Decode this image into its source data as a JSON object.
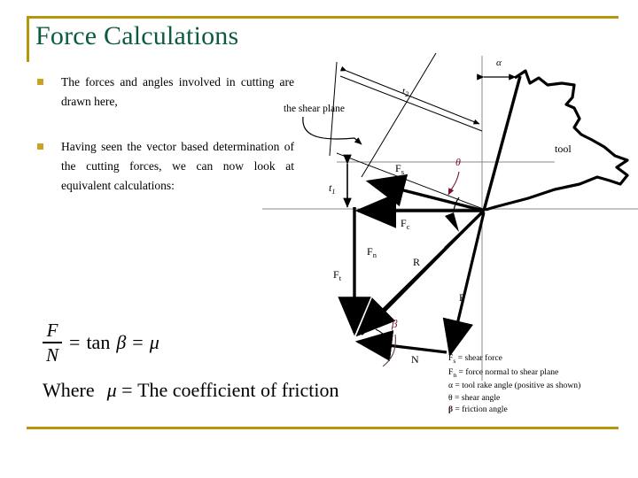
{
  "slide": {
    "title": "Force Calculations",
    "accent_gold": "#b8960b",
    "title_green": "#0b5c3f",
    "bullet_gold": "#c9a227"
  },
  "bullets": [
    {
      "text": "The forces and angles involved in cutting are drawn here,"
    },
    {
      "text": "Having seen the vector based determination of the cutting forces, we can now look at equivalent calculations:"
    }
  ],
  "formula": {
    "numerator": "F",
    "denominator": "N",
    "equals_1": "=",
    "tan": "tan",
    "beta": "β",
    "equals_2": "=",
    "mu": "μ",
    "where": "Where",
    "mu_2": "μ",
    "equals_3": "=",
    "definition": "The coefficient of friction"
  },
  "diagram": {
    "labels": {
      "shear_plane": "the shear plane",
      "t1": "t",
      "t1_sub": "1",
      "t2": "t",
      "t2_sub": "2",
      "alpha": "α",
      "theta": "θ",
      "tool": "tool",
      "Fs": "F",
      "Fs_sub": "s",
      "Fc": "F",
      "Fc_sub": "c",
      "Fn": "F",
      "Fn_sub": "n",
      "Ft": "F",
      "Ft_sub": "t",
      "R": "R",
      "F": "F",
      "N": "N",
      "beta": "β"
    }
  },
  "legend": {
    "rows": [
      {
        "sym": "F",
        "sub": "s",
        "eq": "=",
        "desc": "shear force"
      },
      {
        "sym": "F",
        "sub": "n",
        "eq": "=",
        "desc": "force normal to shear plane"
      },
      {
        "sym": "α",
        "sub": "",
        "eq": "=",
        "desc": "tool rake angle (positive as shown)"
      },
      {
        "sym": "θ",
        "sub": "",
        "eq": "=",
        "desc": "shear angle"
      },
      {
        "sym": "β",
        "sub": "",
        "eq": "=",
        "desc": "friction angle"
      }
    ]
  }
}
